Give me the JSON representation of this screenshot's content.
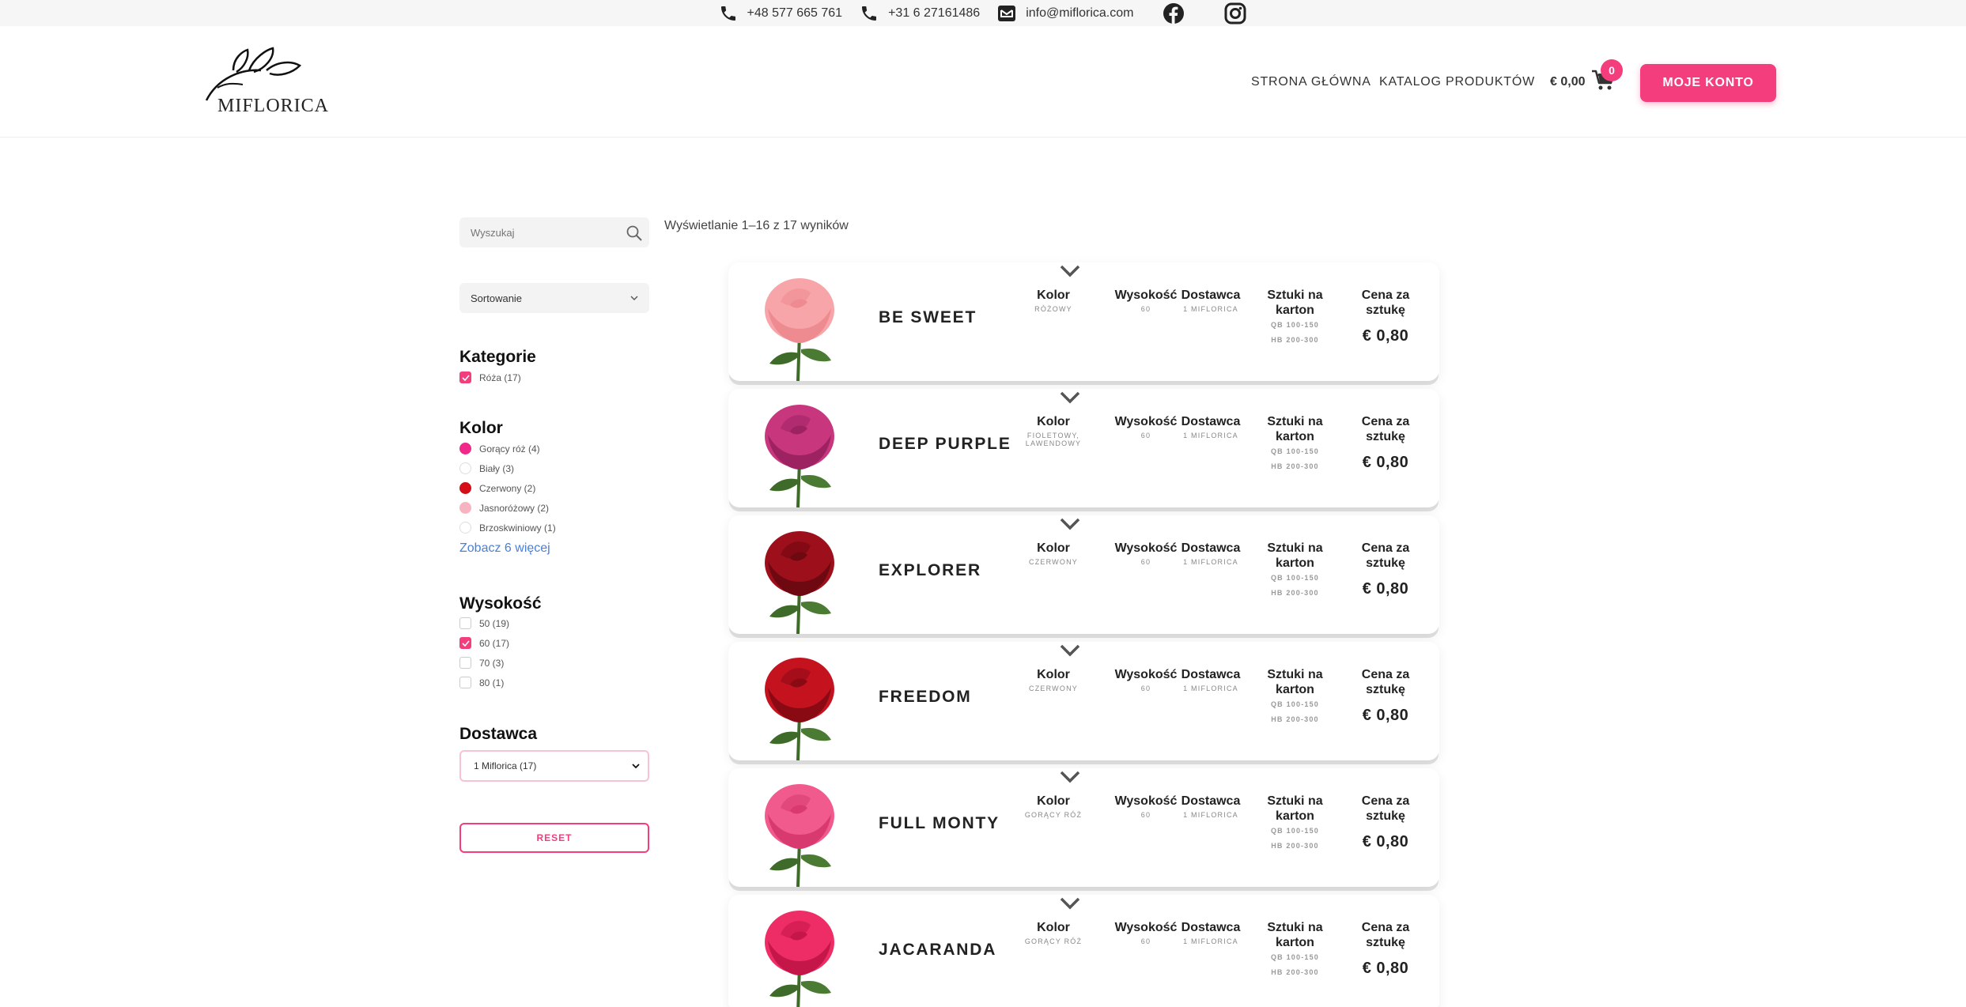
{
  "topbar": {
    "phone1": "+48 577 665 761",
    "phone2": "+31 6 27161486",
    "email": "info@miflorica.com",
    "icons": [
      "phone-icon",
      "phone-icon",
      "mail-icon",
      "facebook-icon",
      "instagram-icon"
    ]
  },
  "header": {
    "logo_text": "MIFLORICA",
    "nav_home": "STRONA GŁÓWNA",
    "nav_catalog": "KATALOG PRODUKTÓW",
    "cart_total": "€ 0,00",
    "cart_count": "0",
    "account_button": "MOJE KONTO"
  },
  "sidebar": {
    "search_placeholder": "Wyszukaj",
    "sort_label": "Sortowanie",
    "categories_title": "Kategorie",
    "categories": [
      {
        "label": "Róża (17)",
        "checked": true
      }
    ],
    "color_title": "Kolor",
    "colors": [
      {
        "label": "Gorący róż (4)",
        "swatch": "#f0288a"
      },
      {
        "label": "Biały (3)",
        "swatch": "#ffffff"
      },
      {
        "label": "Czerwony (2)",
        "swatch": "#d40d16"
      },
      {
        "label": "Jasnoróżowy (2)",
        "swatch": "#f6b4c1"
      },
      {
        "label": "Brzoskwiniowy (1)",
        "swatch": "#ffffff"
      }
    ],
    "see_more": "Zobacz 6 więcej",
    "height_title": "Wysokość",
    "heights": [
      {
        "label": "50 (19)",
        "checked": false
      },
      {
        "label": "60 (17)",
        "checked": true
      },
      {
        "label": "70 (3)",
        "checked": false
      },
      {
        "label": "80 (1)",
        "checked": false
      }
    ],
    "supplier_title": "Dostawca",
    "supplier_selected": "1 Miflorica (17)",
    "reset_button": "RESET"
  },
  "results": {
    "count_text": "Wyświetlanie 1–16 z 17 wyników"
  },
  "labels": {
    "kolor": "Kolor",
    "wysokosc": "Wysokość",
    "dostawca": "Dostawca",
    "sztuki": "Sztuki na karton",
    "cena": "Cena za sztukę"
  },
  "products": [
    {
      "name": "BE SWEET",
      "color": "RÓŻOWY",
      "height": "60",
      "supplier": "1 MIFLORICA",
      "qb": "QB 100-150",
      "hb": "HB 200-300",
      "price": "€ 0,80",
      "petal": "#f7a5a8",
      "petal_dark": "#ee8b91"
    },
    {
      "name": "DEEP PURPLE",
      "color": "FIOLETOWY, LAWENDOWY",
      "height": "60",
      "supplier": "1 MIFLORICA",
      "qb": "QB 100-150",
      "hb": "HB 200-300",
      "price": "€ 0,80",
      "petal": "#c8377e",
      "petal_dark": "#9c2262"
    },
    {
      "name": "EXPLORER",
      "color": "CZERWONY",
      "height": "60",
      "supplier": "1 MIFLORICA",
      "qb": "QB 100-150",
      "hb": "HB 200-300",
      "price": "€ 0,80",
      "petal": "#9e0f1c",
      "petal_dark": "#6e0811"
    },
    {
      "name": "FREEDOM",
      "color": "CZERWONY",
      "height": "60",
      "supplier": "1 MIFLORICA",
      "qb": "QB 100-150",
      "hb": "HB 200-300",
      "price": "€ 0,80",
      "petal": "#c4121f",
      "petal_dark": "#8a0a14"
    },
    {
      "name": "FULL MONTY",
      "color": "GORĄCY RÓŻ",
      "height": "60",
      "supplier": "1 MIFLORICA",
      "qb": "QB 100-150",
      "hb": "HB 200-300",
      "price": "€ 0,80",
      "petal": "#f05a8c",
      "petal_dark": "#d83a70"
    },
    {
      "name": "JACARANDA",
      "color": "GORĄCY RÓŻ",
      "height": "60",
      "supplier": "1 MIFLORICA",
      "qb": "QB 100-150",
      "hb": "HB 200-300",
      "price": "€ 0,80",
      "petal": "#ee2c66",
      "petal_dark": "#c41649"
    }
  ]
}
